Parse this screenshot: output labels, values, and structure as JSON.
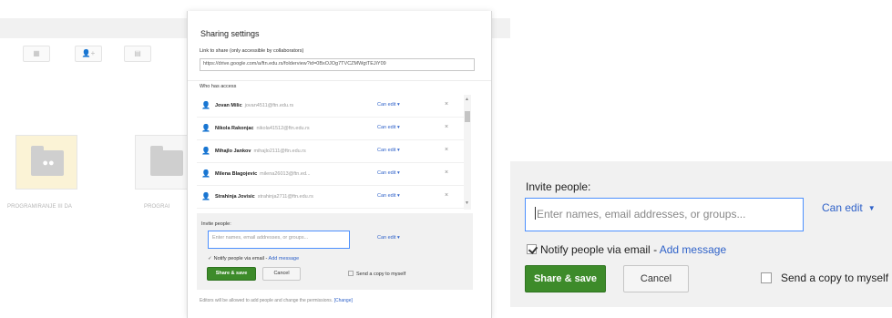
{
  "background": {
    "toolbar_icons": [
      "grid-icon",
      "person-add-icon",
      "view-icon"
    ],
    "folders": [
      {
        "caption": "PROGRAMIRANJE III DA",
        "icon": "shared-folder-icon"
      },
      {
        "caption": "PROGRAI",
        "icon": "folder-icon"
      }
    ]
  },
  "dialog": {
    "title": "Sharing settings",
    "link_label": "Link to share (only accessible by collaborators)",
    "link_value": "https://drive.google.com/a/ftn.edu.rs/folderview?id=0BxOJOg7TVCZMWgtTEJiY09",
    "access_label": "Who has access",
    "people": [
      {
        "name": "Jovan Milic",
        "email": "jovan4511@ftn.edu.rs",
        "permission": "Can edit"
      },
      {
        "name": "Nikola Rakonjac",
        "email": "nikola41512@ftn.edu.rs",
        "permission": "Can edit"
      },
      {
        "name": "Mihajlo Jankov",
        "email": "mihajlo2111@ftn.edu.rs",
        "permission": "Can edit"
      },
      {
        "name": "Milena Blagojevic",
        "email": "milena26013@ftn.ed...",
        "permission": "Can edit"
      },
      {
        "name": "Strahinja Jovisic",
        "email": "strahinja2711@ftn.edu.rs",
        "permission": "Can edit"
      }
    ],
    "remove_symbol": "×",
    "invite": {
      "label": "Invite people:",
      "placeholder": "Enter names, email addresses, or groups...",
      "permission": "Can edit",
      "notify_text": "Notify people via email",
      "notify_separator": " - ",
      "add_message": "Add message",
      "share_label": "Share & save",
      "cancel_label": "Cancel",
      "copy_label": "Send a copy to myself"
    },
    "footer_text": "Editors will be allowed to add people and change the permissions.",
    "footer_link": "[Change]"
  },
  "zoom": {
    "label": "Invite people:",
    "placeholder": "Enter names, email addresses, or groups...",
    "permission": "Can edit",
    "notify_checked": true,
    "notify_text": "Notify people via email",
    "notify_separator": " - ",
    "add_message": "Add message",
    "share_label": "Share & save",
    "cancel_label": "Cancel",
    "copy_label": "Send a copy to myself"
  },
  "colors": {
    "share_button": "#3d8b2a",
    "link": "#2f62c9",
    "input_focus_border": "#4d90fe"
  }
}
